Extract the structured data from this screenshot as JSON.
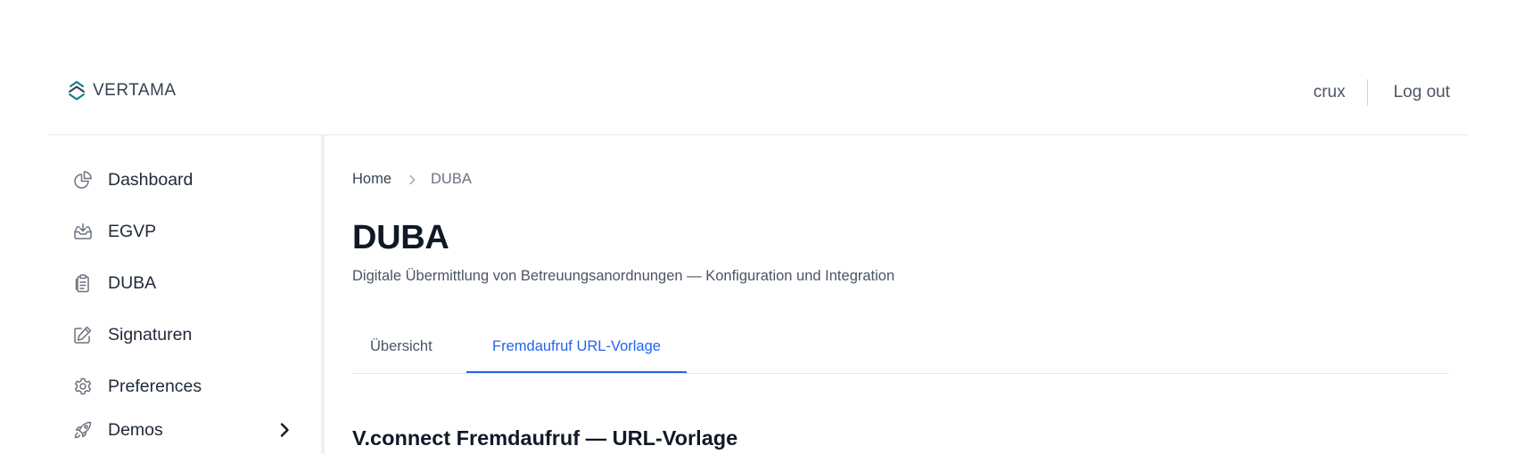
{
  "header": {
    "logo_text": "VERTAMA",
    "username": "crux",
    "logout_label": "Log out"
  },
  "sidebar": {
    "items": [
      {
        "label": "Dashboard",
        "icon": "chart-pie-icon"
      },
      {
        "label": "EGVP",
        "icon": "inbox-download-icon"
      },
      {
        "label": "DUBA",
        "icon": "clipboard-documents-icon"
      },
      {
        "label": "Signaturen",
        "icon": "pencil-square-icon"
      },
      {
        "label": "Preferences",
        "icon": "gear-icon"
      },
      {
        "label": "Demos",
        "icon": "rocket-icon",
        "expandable": true
      }
    ]
  },
  "breadcrumb": {
    "home": "Home",
    "current": "DUBA"
  },
  "page": {
    "title": "DUBA",
    "subtitle": "Digitale Übermittlung von Betreuungsanordnungen — Konfiguration und Integration"
  },
  "tabs": [
    {
      "label": "Übersicht",
      "active": false
    },
    {
      "label": "Fremdaufruf URL-Vorlage",
      "active": true
    }
  ],
  "section": {
    "heading": "V.connect Fremdaufruf — URL-Vorlage"
  },
  "colors": {
    "accent": "#2563eb",
    "logo_teal": "#0e7c86",
    "text_dark": "#111827",
    "text_muted": "#4b5563",
    "border": "#e5e7eb"
  }
}
